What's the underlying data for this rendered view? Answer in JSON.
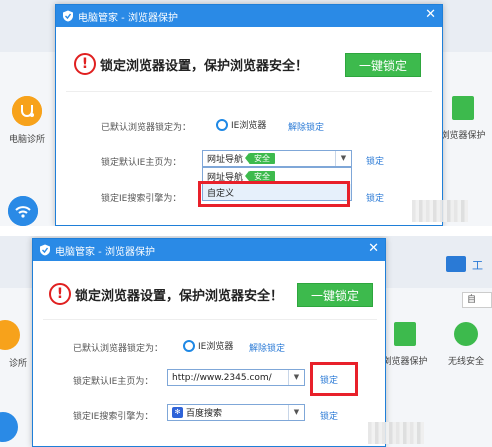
{
  "top": {
    "dialog": {
      "title": "电脑管家 - 浏览器保护",
      "headline": "锁定浏览器设置，保护浏览器安全！",
      "lock_button": "一键锁定",
      "default_browser_label": "已默认浏览器锁定为：",
      "default_browser_value": "IE浏览器",
      "unlock_link": "解除锁定",
      "homepage_label": "锁定默认IE主页为：",
      "homepage_value": "网址导航",
      "homepage_badge": "安全",
      "homepage_lock_link": "锁定",
      "dropdown_options": [
        {
          "label": "网址导航",
          "badge": "安全"
        },
        {
          "label": "自定义"
        }
      ],
      "search_label": "锁定IE搜索引擎为：",
      "search_lock_link": "锁定"
    },
    "background": {
      "left_tile": "电脑诊所",
      "right_tile": "浏览器保护"
    }
  },
  "bottom": {
    "dialog": {
      "title": "电脑管家 - 浏览器保护",
      "headline": "锁定浏览器设置，保护浏览器安全！",
      "lock_button": "一键锁定",
      "default_browser_label": "已默认浏览器锁定为：",
      "default_browser_value": "IE浏览器",
      "unlock_link": "解除锁定",
      "homepage_label": "锁定默认IE主页为：",
      "homepage_value": "http://www.2345.com/",
      "homepage_lock_link": "锁定",
      "search_label": "锁定IE搜索引擎为：",
      "search_value": "百度搜索",
      "search_lock_link": "锁定"
    },
    "background": {
      "left_tile": "诊所",
      "right_tile_1": "浏览器保护",
      "right_tile_2": "无线安全",
      "toolbox_label": "工",
      "side_button": "自"
    }
  },
  "colors": {
    "title_bar": "#2a8ae6",
    "lock_button": "#3dba4d",
    "safe_badge": "#3dba4d",
    "highlight_box": "#e8202a",
    "link": "#2a7ad6"
  },
  "icons": [
    "shield-logo-icon",
    "warning-icon",
    "ie-icon",
    "close-icon",
    "dropdown-arrow-icon",
    "baidu-icon",
    "stethoscope-icon",
    "wifi-icon",
    "toolbox-icon"
  ]
}
